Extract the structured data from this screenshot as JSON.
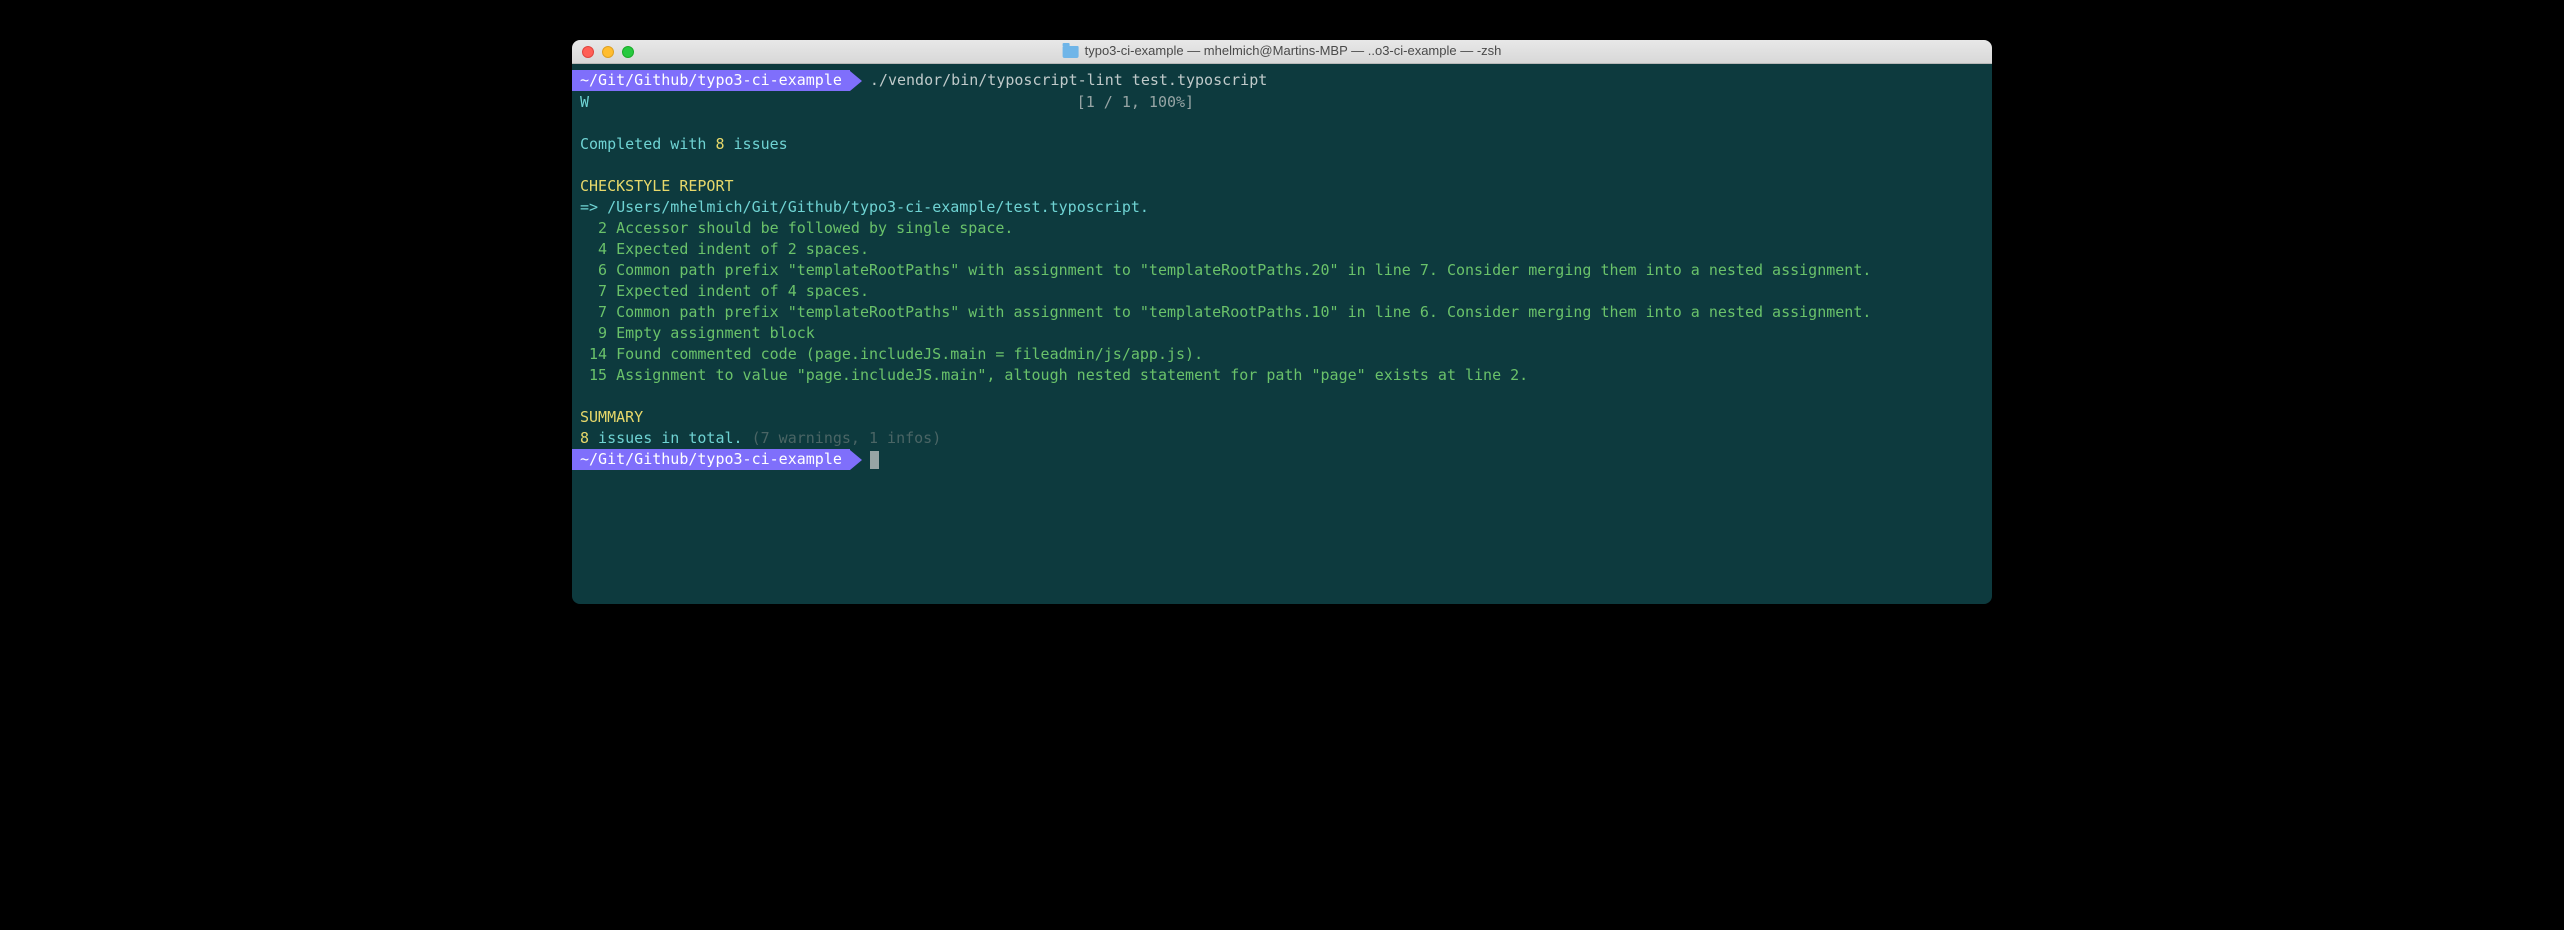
{
  "titlebar": {
    "title": "typo3-ci-example — mhelmich@Martins-MBP — ..o3-ci-example — -zsh"
  },
  "prompt": {
    "path": "~/Git/Github/typo3-ci-example",
    "command": "./vendor/bin/typoscript-lint test.typoscript"
  },
  "progress": {
    "marker": "W",
    "info": "[1 / 1, 100%]"
  },
  "completed": {
    "prefix": "Completed with ",
    "count": "8",
    "suffix": " issues"
  },
  "checkstyle": {
    "header": "CHECKSTYLE REPORT",
    "arrow": "=> ",
    "file": "/Users/mhelmich/Git/Github/typo3-ci-example/test.typoscript.",
    "issues": [
      {
        "line": "2",
        "msg": "Accessor should be followed by single space."
      },
      {
        "line": "4",
        "msg": "Expected indent of 2 spaces."
      },
      {
        "line": "6",
        "msg": "Common path prefix \"templateRootPaths\" with assignment to \"templateRootPaths.20\" in line 7. Consider merging them into a nested assignment."
      },
      {
        "line": "7",
        "msg": "Expected indent of 4 spaces."
      },
      {
        "line": "7",
        "msg": "Common path prefix \"templateRootPaths\" with assignment to \"templateRootPaths.10\" in line 6. Consider merging them into a nested assignment."
      },
      {
        "line": "9",
        "msg": "Empty assignment block"
      },
      {
        "line": "14",
        "msg": "Found commented code (page.includeJS.main = fileadmin/js/app.js)."
      },
      {
        "line": "15",
        "msg": "Assignment to value \"page.includeJS.main\", altough nested statement for path \"page\" exists at line 2."
      }
    ]
  },
  "summary": {
    "header": "SUMMARY",
    "count": "8",
    "text": " issues in total. ",
    "details": "(7 warnings, 1 infos)"
  },
  "prompt2": {
    "path": "~/Git/Github/typo3-ci-example"
  }
}
